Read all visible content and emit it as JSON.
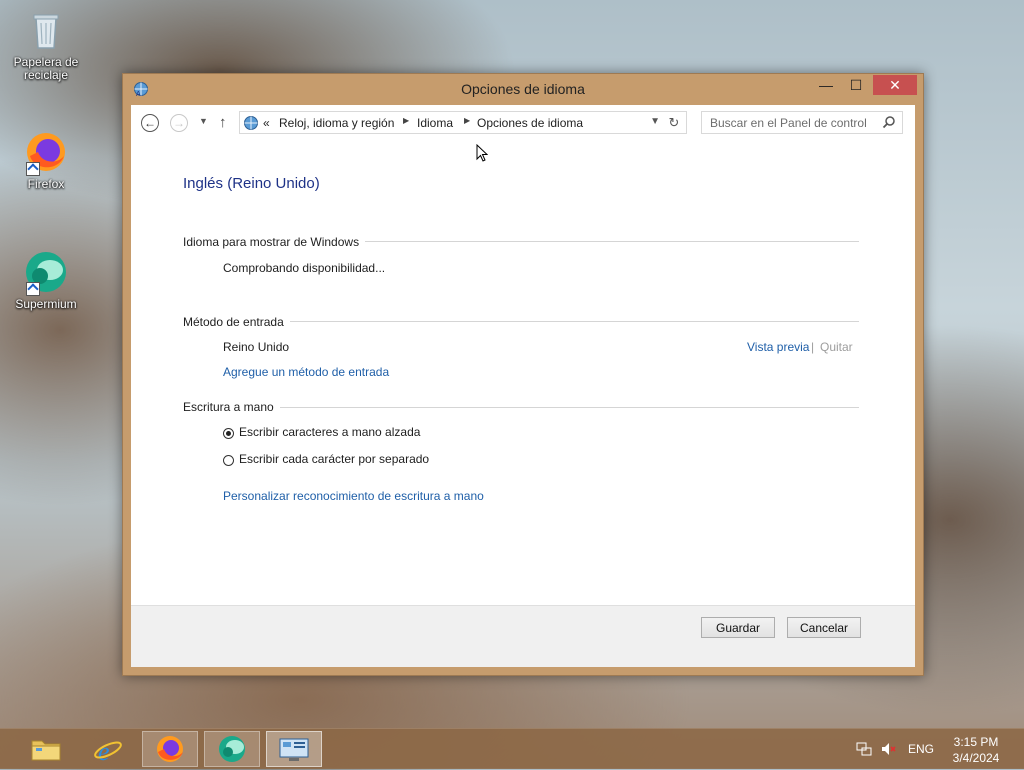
{
  "desktop": {
    "icons": [
      {
        "label": "Papelera de reciclaje"
      },
      {
        "label": "Firefox"
      },
      {
        "label": "Supermium"
      }
    ]
  },
  "window": {
    "title": "Opciones de idioma",
    "controls": {
      "minimize": "—",
      "maximize": "☐",
      "close": "✕"
    }
  },
  "addressbar": {
    "prefix": "«",
    "crumbs": [
      "Reloj, idioma y región",
      "Idioma",
      "Opciones de idioma"
    ]
  },
  "search": {
    "placeholder": "Buscar en el Panel de control"
  },
  "language": {
    "heading": "Inglés (Reino Unido)",
    "display_section": {
      "title": "Idioma para mostrar de Windows",
      "status": "Comprobando disponibilidad..."
    },
    "input_section": {
      "title": "Método de entrada",
      "method_name": "Reino Unido",
      "preview_link": "Vista previa",
      "separator": "|",
      "remove_link": "Quitar",
      "add_link": "Agregue un método de entrada"
    },
    "handwriting_section": {
      "title": "Escritura a mano",
      "options": [
        {
          "label": "Escribir caracteres a mano alzada",
          "selected": true
        },
        {
          "label": "Escribir cada carácter por separado",
          "selected": false
        }
      ],
      "personalize_link": "Personalizar reconocimiento de escritura a mano"
    }
  },
  "footer": {
    "save": "Guardar",
    "cancel": "Cancelar"
  },
  "taskbar": {
    "apps": [
      "file-explorer",
      "internet-explorer",
      "firefox",
      "supermium",
      "control-panel"
    ],
    "tray": {
      "language": "ENG",
      "time": "3:15 PM",
      "date": "3/4/2024"
    }
  },
  "colors": {
    "accent_link": "#1f5fa8",
    "heading": "#1e3287",
    "window_frame": "#c69c6d",
    "close_button": "#c75050"
  }
}
